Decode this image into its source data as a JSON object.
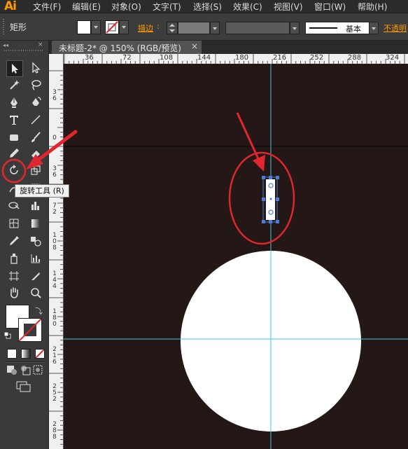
{
  "app": {
    "logo": "Ai",
    "accent_color": "#ff9a00"
  },
  "menu": {
    "items": [
      {
        "label": "文件(F)"
      },
      {
        "label": "编辑(E)"
      },
      {
        "label": "对象(O)"
      },
      {
        "label": "文字(T)"
      },
      {
        "label": "选择(S)"
      },
      {
        "label": "效果(C)"
      },
      {
        "label": "视图(V)"
      },
      {
        "label": "窗口(W)"
      },
      {
        "label": "帮助(H)"
      }
    ]
  },
  "control_bar": {
    "selection_label": "矩形",
    "fill_color": "#ffffff",
    "stroke_color": "none",
    "stroke_label": "描边",
    "stroke_weight": "",
    "stroke_profile": "基本",
    "opacity_label": "不透明"
  },
  "document": {
    "tab_title": "未标题-2* @ 150% (RGB/预览)",
    "close_glyph": "×",
    "zoom_percent": 150,
    "artboard_color": "#231815",
    "guide_color": "#42c6e0"
  },
  "rulers": {
    "horizontal_labels": [
      "36",
      "72",
      "108",
      "144",
      "180",
      "216",
      "252",
      "288",
      "324"
    ],
    "vertical_labels": [
      "36",
      "0",
      "36",
      "72",
      "108",
      "144",
      "180",
      "216",
      "252",
      "288"
    ]
  },
  "tools": {
    "rotate_tool_tooltip": "旋转工具 (R)",
    "selected_tool": "selection-tool",
    "fill_swatch": "#ffffff",
    "stroke_swatch": "none"
  },
  "annotations": {
    "highlight_color": "#e0262e"
  }
}
